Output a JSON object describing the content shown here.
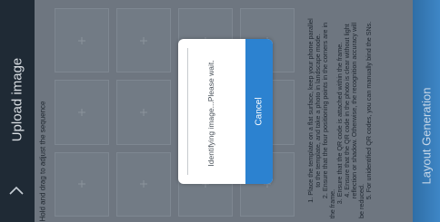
{
  "header": {
    "title": "Upload image",
    "back_icon": "chevron-left-icon"
  },
  "hint": "Hold and drag to adjust the sequence",
  "instructions": [
    "1. Place the template on a flat surface, keep your phone parallel",
    "to the template, and take a photo in landscape mode.",
    "2. Ensure that the four positioning points in the corners are in",
    "the frame.",
    "3. Ensure that the QR code is attached within the frame.",
    "4. Ensure that the QR code in the photo is clear without light",
    "reflection or shadow. Otherwise, the recognition accuracy will",
    "be reduced.",
    "5. For unidentified QR codes, you can manually bind the SNs."
  ],
  "layout_button": {
    "label": "Layout Generation"
  },
  "dialog": {
    "message": "Identifying image...Please wait.",
    "cancel_label": "Cancel"
  },
  "colors": {
    "header_bg": "#1f2a35",
    "accent": "#2c82d0",
    "overlay": "#6e7680"
  }
}
